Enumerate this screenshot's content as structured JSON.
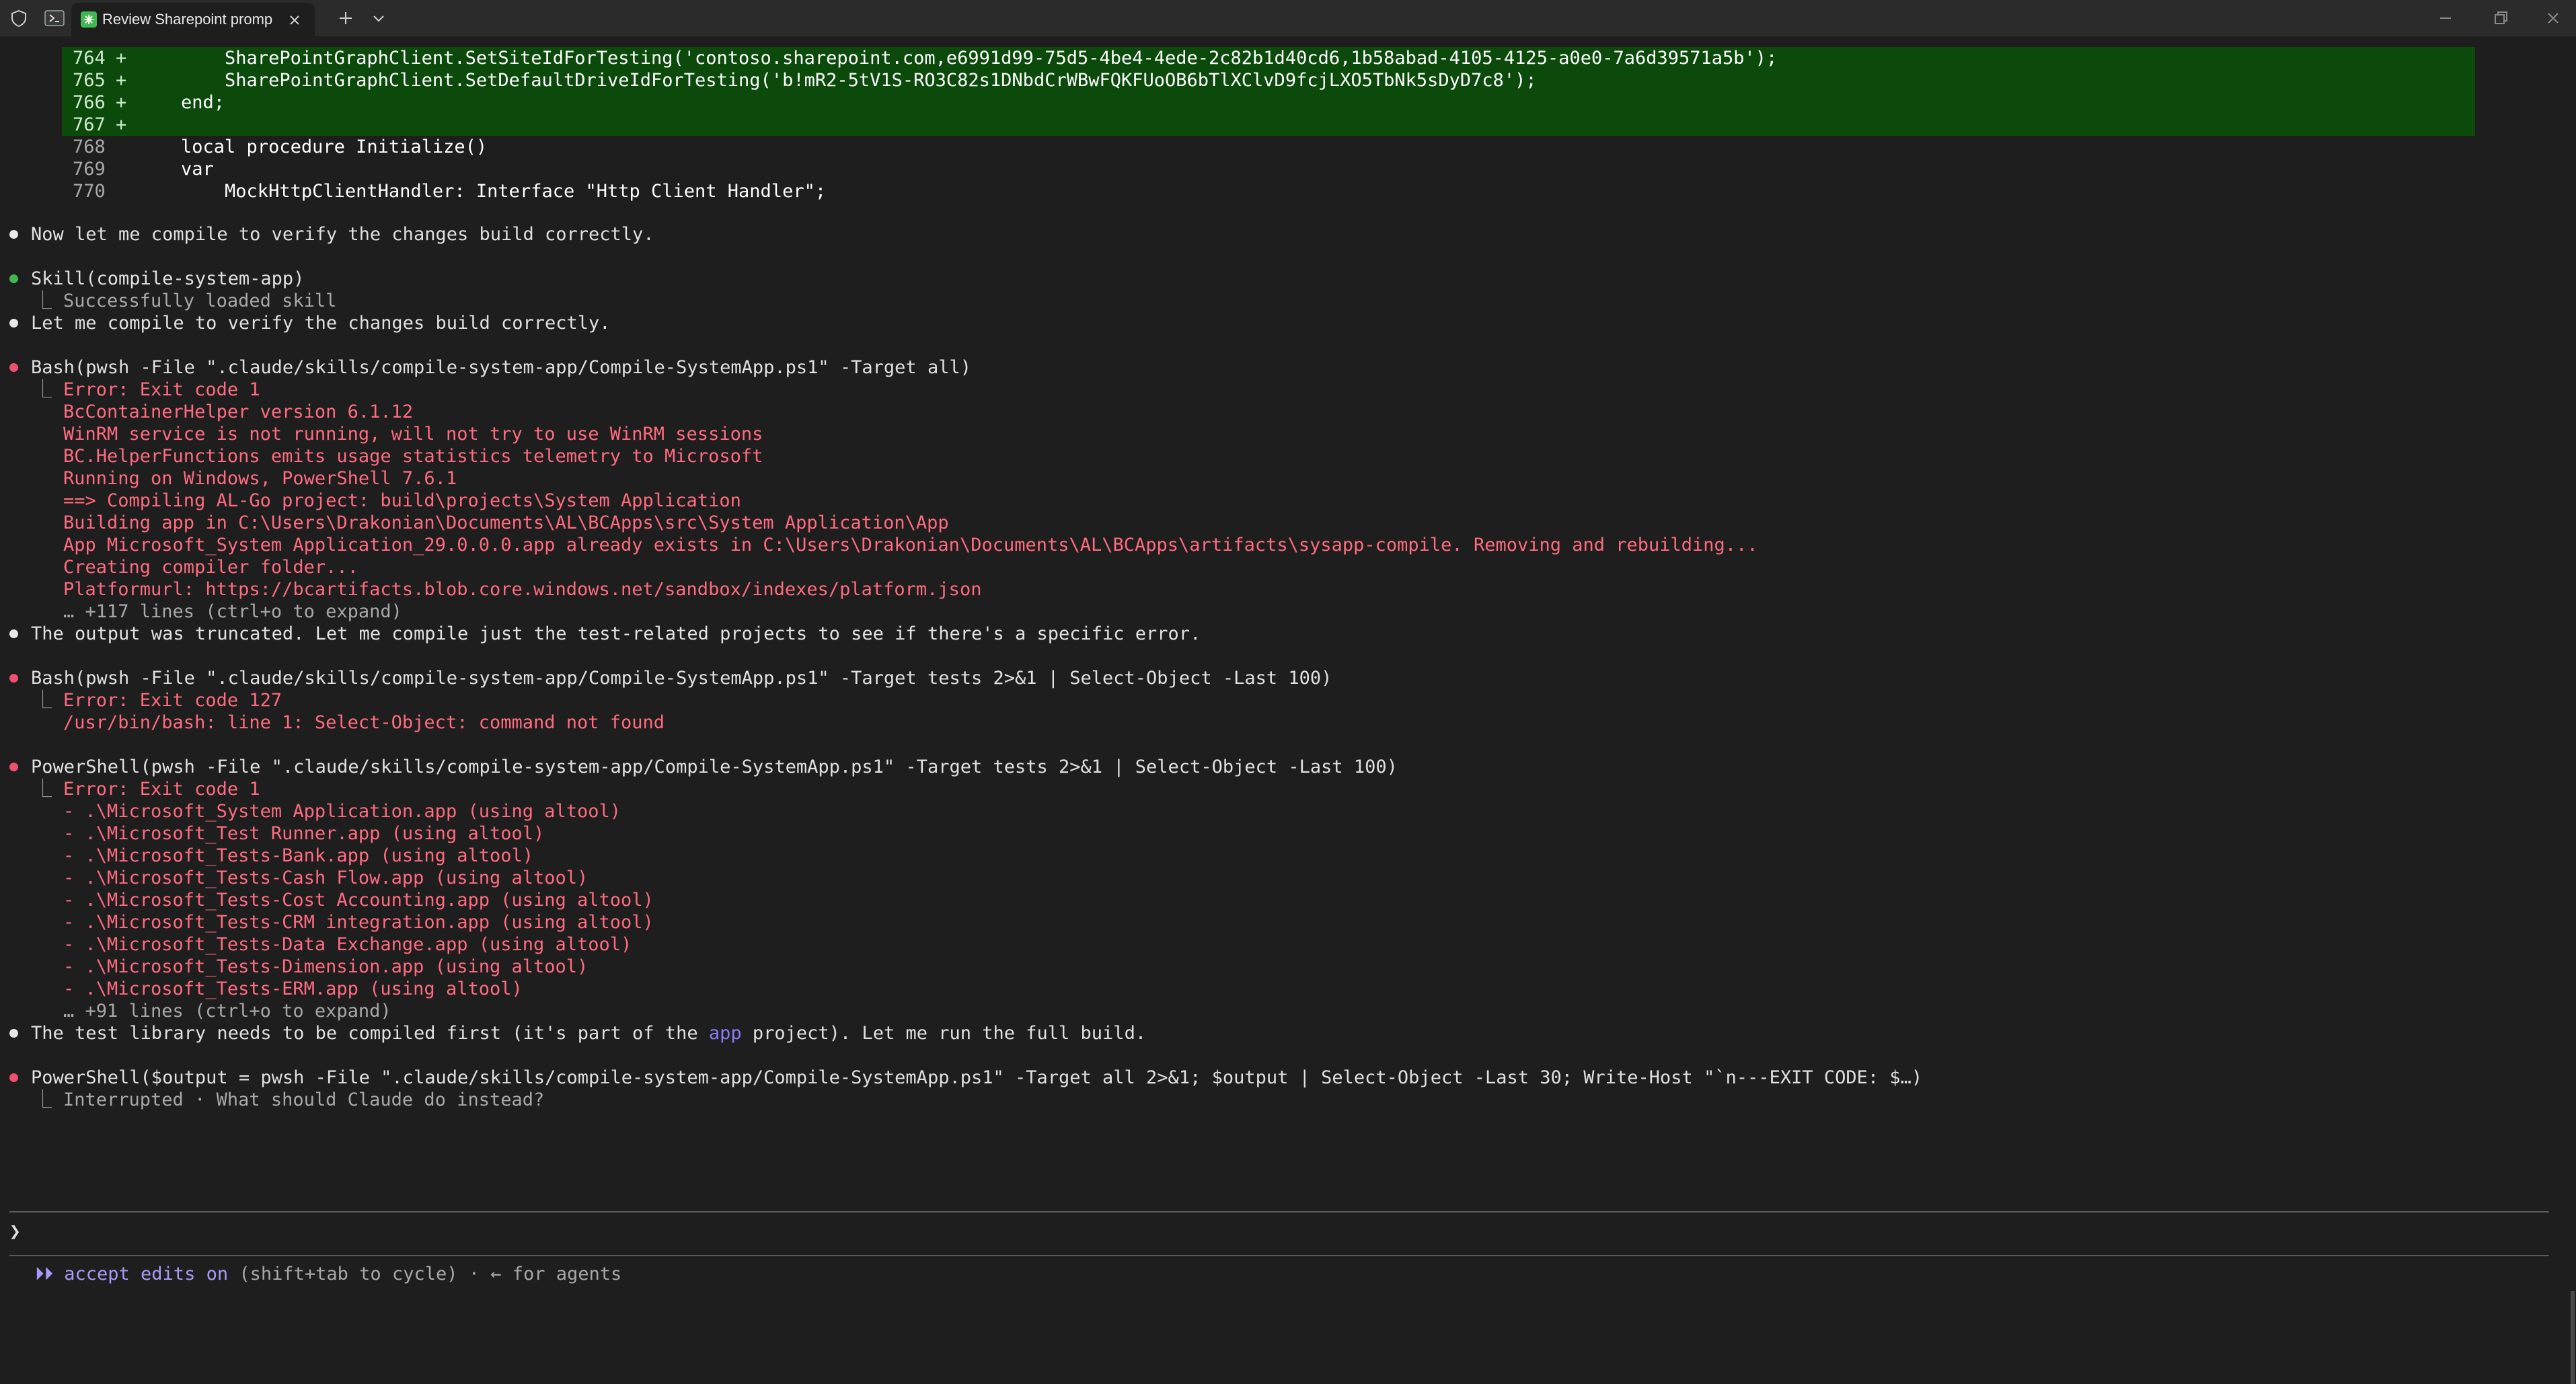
{
  "titlebar": {
    "tab_title": "Review Sharepoint promp"
  },
  "diff": [
    {
      "num": "764",
      "marker": "+",
      "code": "        SharePointGraphClient.SetSiteIdForTesting('contoso.sharepoint.com,e6991d99-75d5-4be4-4ede-2c82b1d40cd6,1b58abad-4105-4125-a0e0-7a6d39571a5b');"
    },
    {
      "num": "765",
      "marker": "+",
      "code": "        SharePointGraphClient.SetDefaultDriveIdForTesting('b!mR2-5tV1S-RO3C82s1DNbdCrWBwFQKFUoOB6bTlXClvD9fcjLXO5TbNk5sDyD7c8');"
    },
    {
      "num": "766",
      "marker": "+",
      "code": "    end;"
    },
    {
      "num": "767",
      "marker": "+",
      "code": ""
    },
    {
      "num": "768",
      "marker": " ",
      "code": "    local procedure Initialize()"
    },
    {
      "num": "769",
      "marker": " ",
      "code": "    var"
    },
    {
      "num": "770",
      "marker": " ",
      "code": "        MockHttpClientHandler: Interface \"Http Client Handler\";"
    }
  ],
  "messages": {
    "m1": "Now let me compile to verify the changes build correctly.",
    "skill_title": "Skill(compile-system-app)",
    "skill_result": "Successfully loaded skill",
    "m2": "Let me compile to verify the changes build correctly.",
    "bash1": "Bash(pwsh -File \".claude/skills/compile-system-app/Compile-SystemApp.ps1\" -Target all)",
    "bash1_out": [
      "Error: Exit code 1",
      "BcContainerHelper version 6.1.12",
      "WinRM service is not running, will not try to use WinRM sessions",
      "BC.HelperFunctions emits usage statistics telemetry to Microsoft",
      "Running on Windows, PowerShell 7.6.1",
      "==> Compiling AL-Go project: build\\projects\\System Application",
      "Building app in C:\\Users\\Drakonian\\Documents\\AL\\BCApps\\src\\System Application\\App",
      "App Microsoft_System Application_29.0.0.0.app already exists in C:\\Users\\Drakonian\\Documents\\AL\\BCApps\\artifacts\\sysapp-compile. Removing and rebuilding...",
      "Creating compiler folder...",
      "Platformurl: https://bcartifacts.blob.core.windows.net/sandbox/indexes/platform.json"
    ],
    "bash1_more": "… +117 lines (ctrl+o to expand)",
    "m3": "The output was truncated. Let me compile just the test-related projects to see if there's a specific error.",
    "bash2": "Bash(pwsh -File \".claude/skills/compile-system-app/Compile-SystemApp.ps1\" -Target tests 2>&1 | Select-Object -Last 100)",
    "bash2_out": [
      "Error: Exit code 127",
      "/usr/bin/bash: line 1: Select-Object: command not found"
    ],
    "ps1": "PowerShell(pwsh -File \".claude/skills/compile-system-app/Compile-SystemApp.ps1\" -Target tests 2>&1 | Select-Object -Last 100)",
    "ps1_out": [
      "Error: Exit code 1",
      "- .\\Microsoft_System Application.app (using altool)",
      "- .\\Microsoft_Test Runner.app (using altool)",
      "- .\\Microsoft_Tests-Bank.app (using altool)",
      "- .\\Microsoft_Tests-Cash Flow.app (using altool)",
      "- .\\Microsoft_Tests-Cost Accounting.app (using altool)",
      "- .\\Microsoft_Tests-CRM integration.app (using altool)",
      "- .\\Microsoft_Tests-Data Exchange.app (using altool)",
      "- .\\Microsoft_Tests-Dimension.app (using altool)",
      "- .\\Microsoft_Tests-ERM.app (using altool)"
    ],
    "ps1_more": "… +91 lines (ctrl+o to expand)",
    "m4_a": "The test library needs to be compiled first (it's part of the ",
    "m4_hl": "app",
    "m4_b": " project). Let me run the full build.",
    "ps2": "PowerShell($output = pwsh -File \".claude/skills/compile-system-app/Compile-SystemApp.ps1\" -Target all 2>&1; $output | Select-Object -Last 30; Write-Host \"`n---EXIT CODE: $…)",
    "ps2_out": "Interrupted · What should Claude do instead?"
  },
  "input": {
    "prompt_glyph": "❯",
    "value": ""
  },
  "status": {
    "mode_icon": "⏵⏵",
    "mode_label": "accept edits on",
    "mode_hint": " (shift+tab to cycle) · ← for agents"
  },
  "colors": {
    "background": "#1e1e1e",
    "diff_added": "#0b4a0b",
    "error_red": "#ff6b7f",
    "accent_purple": "#a99af8",
    "success_green": "#3fb950"
  }
}
